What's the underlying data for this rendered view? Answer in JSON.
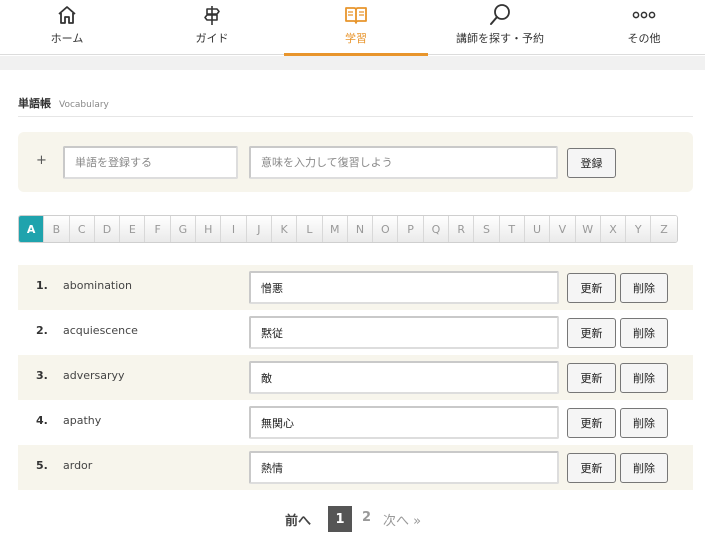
{
  "nav": {
    "items": [
      {
        "label": "ホーム",
        "icon": "home-icon"
      },
      {
        "label": "ガイド",
        "icon": "signpost-icon"
      },
      {
        "label": "学習",
        "icon": "book-icon",
        "active": true
      },
      {
        "label": "講師を探す・予約",
        "icon": "search-icon"
      },
      {
        "label": "その他",
        "icon": "more-icon"
      }
    ],
    "accent": "#e8952c"
  },
  "title": {
    "main": "単語帳",
    "sub": "Vocabulary"
  },
  "add": {
    "plus": "+",
    "word_placeholder": "単語を登録する",
    "meaning_placeholder": "意味を入力して復習しよう",
    "register_label": "登録"
  },
  "alphabet": {
    "letters": [
      "A",
      "B",
      "C",
      "D",
      "E",
      "F",
      "G",
      "H",
      "I",
      "J",
      "K",
      "L",
      "M",
      "N",
      "O",
      "P",
      "Q",
      "R",
      "S",
      "T",
      "U",
      "V",
      "W",
      "X",
      "Y",
      "Z"
    ],
    "active": "A",
    "active_color": "#1fa3ad"
  },
  "entries": [
    {
      "num": "1.",
      "word": "abomination",
      "meaning": "憎悪"
    },
    {
      "num": "2.",
      "word": "acquiescence",
      "meaning": "黙従"
    },
    {
      "num": "3.",
      "word": "adversaryy",
      "meaning": "敵"
    },
    {
      "num": "4.",
      "word": "apathy",
      "meaning": "無関心"
    },
    {
      "num": "5.",
      "word": "ardor",
      "meaning": "熱情"
    }
  ],
  "row_buttons": {
    "update": "更新",
    "delete": "削除"
  },
  "pager": {
    "prev": "前へ",
    "current": "1",
    "page2": "2",
    "next": "次へ »"
  }
}
